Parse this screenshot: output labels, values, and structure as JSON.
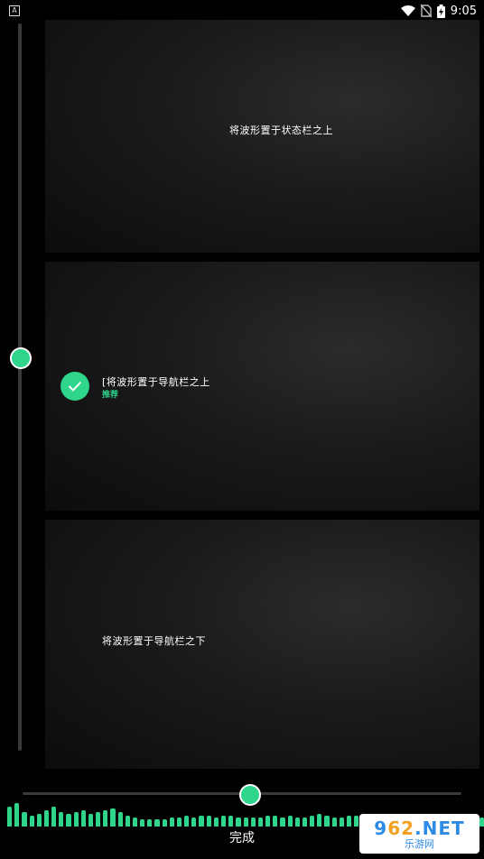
{
  "statusbar": {
    "left_badge": "A",
    "time": "9:05"
  },
  "panels": [
    {
      "label": "将波形置于状态栏之上"
    },
    {
      "label": "[将波形置于导航栏之上",
      "sub": "推荐",
      "selected": true
    },
    {
      "label": "将波形置于导航栏之下"
    }
  ],
  "vertical_slider": {
    "value": 0.46
  },
  "horizontal_slider": {
    "value": 0.5
  },
  "waveform_heights": [
    22,
    26,
    16,
    12,
    14,
    18,
    22,
    16,
    14,
    16,
    18,
    14,
    16,
    18,
    20,
    16,
    12,
    10,
    8,
    8,
    8,
    8,
    10,
    10,
    12,
    10,
    12,
    12,
    10,
    12,
    12,
    10,
    10,
    10,
    10,
    12,
    12,
    10,
    12,
    10,
    10,
    12,
    14,
    12,
    10,
    10,
    12,
    12,
    10,
    10,
    10,
    12,
    10,
    10,
    12,
    12,
    10,
    10,
    10,
    10,
    12,
    12,
    10,
    10,
    10
  ],
  "done_label": "完成",
  "watermark": {
    "top_a": "9",
    "top_b": "62",
    "top_c": ".NET",
    "bottom": "乐游网"
  },
  "colors": {
    "accent": "#2ed58a"
  }
}
